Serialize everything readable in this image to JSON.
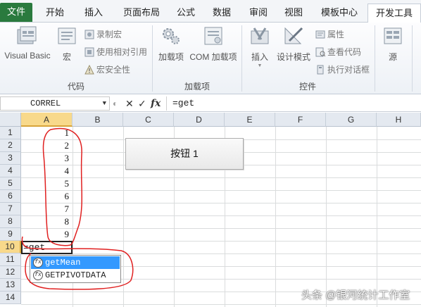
{
  "ribbon_tabs": [
    "文件",
    "开始",
    "插入",
    "页面布局",
    "公式",
    "数据",
    "审阅",
    "视图",
    "模板中心",
    "开发工具"
  ],
  "active_tab": "开发工具",
  "groups": {
    "code": {
      "label": "代码",
      "visual_basic": "Visual Basic",
      "macros": "宏",
      "record_macro": "录制宏",
      "relative_ref": "使用相对引用",
      "macro_security": "宏安全性"
    },
    "addins": {
      "label": "加载项",
      "addins": "加载项",
      "com_addins": "COM 加载项"
    },
    "controls": {
      "label": "控件",
      "insert": "插入",
      "design_mode": "设计模式",
      "properties": "属性",
      "view_code": "查看代码",
      "run_dialog": "执行对话框"
    },
    "source": "源"
  },
  "formula_bar": {
    "name_box": "CORREL",
    "formula": "=get",
    "fx": "fx"
  },
  "columns": [
    "A",
    "B",
    "C",
    "D",
    "E",
    "F",
    "G",
    "H"
  ],
  "rows": [
    "1",
    "2",
    "3",
    "4",
    "5",
    "6",
    "7",
    "8",
    "9",
    "10",
    "11",
    "12",
    "13",
    "14"
  ],
  "cells_a": [
    "1",
    "2",
    "3",
    "4",
    "5",
    "6",
    "7",
    "8",
    "9"
  ],
  "editing_cell": "=get",
  "sheet_button": "按钮 1",
  "autocomplete": [
    "getMean",
    "GETPIVOTDATA"
  ],
  "watermark": "头条 @银河统计工作室",
  "colors": {
    "file_tab": "#2a7a3e",
    "selected_header": "#f8d98b",
    "autocomplete_highlight": "#3399ff",
    "annotation": "#e02020"
  }
}
